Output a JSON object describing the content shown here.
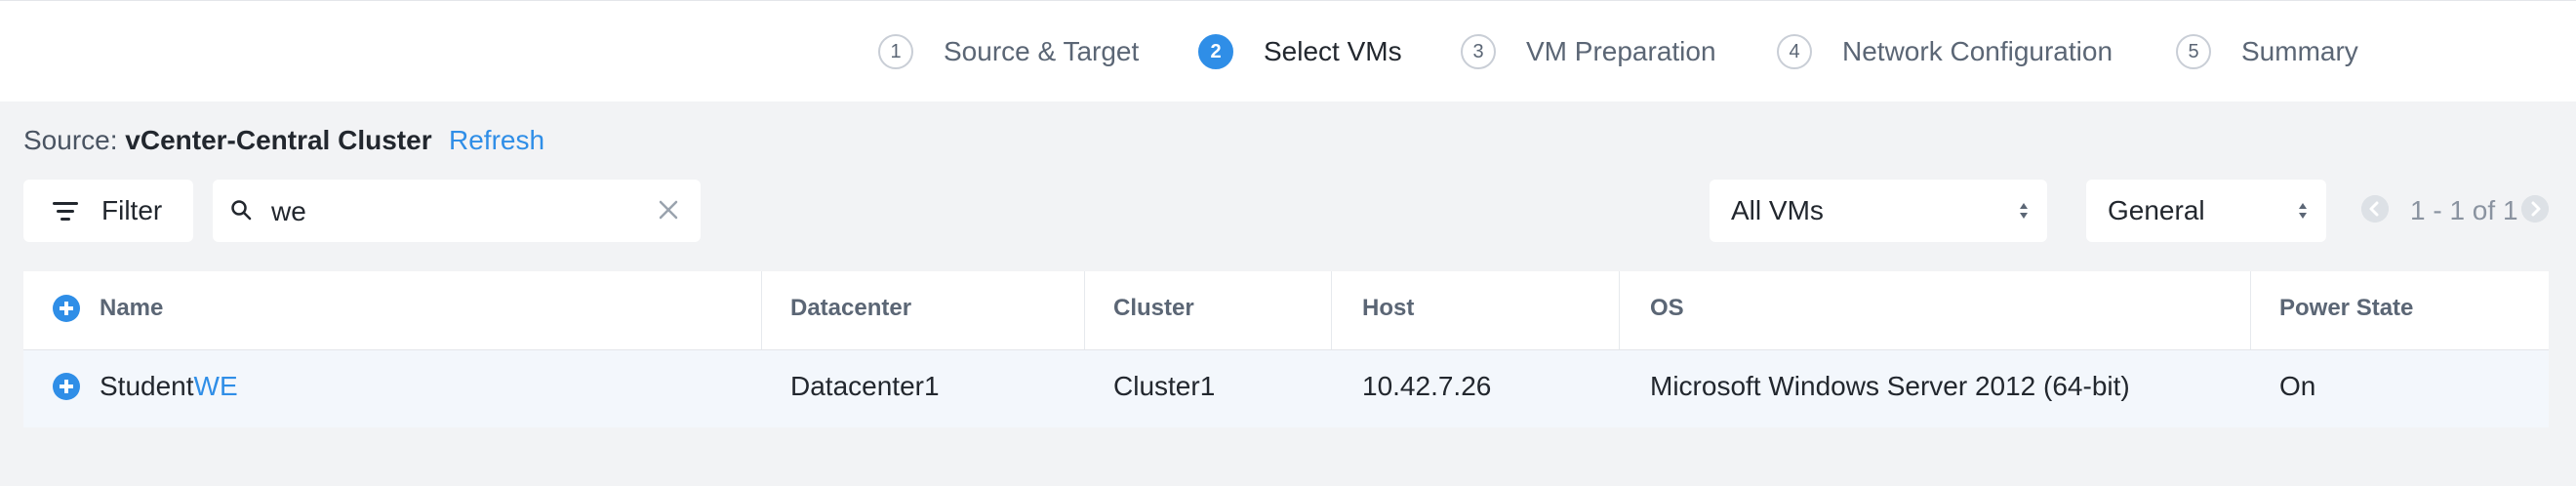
{
  "wizard": {
    "steps": [
      {
        "num": "1",
        "label": "Source & Target",
        "active": false
      },
      {
        "num": "2",
        "label": "Select VMs",
        "active": true
      },
      {
        "num": "3",
        "label": "VM Preparation",
        "active": false
      },
      {
        "num": "4",
        "label": "Network Configuration",
        "active": false
      },
      {
        "num": "5",
        "label": "Summary",
        "active": false
      }
    ]
  },
  "source": {
    "prefix": "Source: ",
    "value": "vCenter-Central Cluster",
    "refresh_label": "Refresh"
  },
  "toolbar": {
    "filter_label": "Filter",
    "search_value": "we",
    "vm_scope_select": "All VMs",
    "view_select": "General",
    "pagination_text": "1 - 1 of 1"
  },
  "table": {
    "columns": [
      "Name",
      "Datacenter",
      "Cluster",
      "Host",
      "OS",
      "Power State"
    ],
    "rows": [
      {
        "name_prefix": "Student",
        "name_match": "WE",
        "datacenter": "Datacenter1",
        "cluster": "Cluster1",
        "host": "10.42.7.26",
        "os": "Microsoft Windows Server 2012 (64-bit)",
        "power_state": "On"
      }
    ]
  },
  "colors": {
    "accent": "#2f8ee7",
    "background": "#f2f3f5",
    "panel": "#ffffff",
    "text_primary": "#22272e",
    "text_secondary": "#5b6675"
  },
  "icons": [
    "filter-icon",
    "search-icon",
    "clear-icon",
    "select-caret-icon",
    "prev-page-icon",
    "next-page-icon",
    "add-all-icon",
    "add-row-icon"
  ]
}
